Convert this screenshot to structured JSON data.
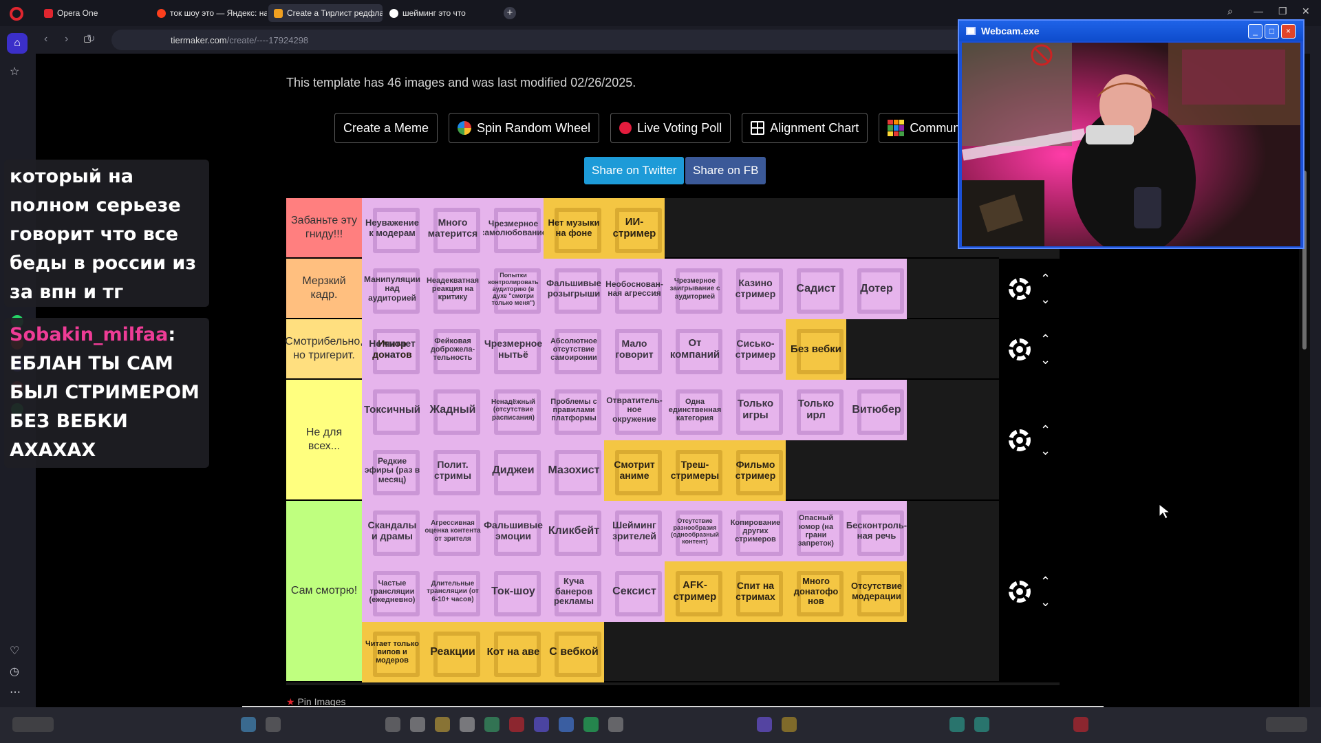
{
  "browser": {
    "tabs": [
      {
        "label": "Opera One",
        "active": false
      },
      {
        "label": "ток шоу это — Яндекс: на",
        "active": false
      },
      {
        "label": "Create a Тирлист редфлаг",
        "active": true
      },
      {
        "label": "шейминг это что",
        "active": false
      }
    ],
    "url_domain": "tiermaker.com",
    "url_path": "/create/----17924298",
    "new_tab": "+"
  },
  "page": {
    "template_info": "This template has 46 images and was last modified 02/26/2025.",
    "buttons": {
      "create_meme": "Create a Meme",
      "spin_wheel": "Spin Random Wheel",
      "live_poll": "Live Voting Poll",
      "alignment_chart": "Alignment Chart",
      "community": "Commun"
    },
    "share_twitter": "Share on Twitter",
    "share_fb": "Share on FB",
    "pin_images": "Pin Images"
  },
  "tiers": [
    {
      "label": "Забаньте эту гниду!!!",
      "color": "#ff7f7f",
      "items": [
        {
          "text": "Неуважение к модерам",
          "color": "pink"
        },
        {
          "text": "Много матерится",
          "color": "pink"
        },
        {
          "text": "Чрезмерное самолюбование",
          "color": "pink"
        },
        {
          "text": "Нет музыки на фоне",
          "color": "gold"
        },
        {
          "text": "ИИ-стример",
          "color": "gold"
        }
      ]
    },
    {
      "label": "Мерзкий кадр.",
      "color": "#ffbf7f",
      "items": [
        {
          "text": "Манипуляции над аудиторией",
          "color": "pink"
        },
        {
          "text": "Неадекватная реакция на критику",
          "color": "pink"
        },
        {
          "text": "Попытки контролировать аудиторию (в духе \"смотри только меня\")",
          "color": "pink"
        },
        {
          "text": "Фальшивые розыгрыши",
          "color": "pink"
        },
        {
          "text": "Необоснован-ная агрессия",
          "color": "pink"
        },
        {
          "text": "Чрезмерное заигрывание с аудиторией",
          "color": "pink"
        },
        {
          "text": "Казино стример",
          "color": "pink"
        },
        {
          "text": "Садист",
          "color": "pink"
        },
        {
          "text": "Дотер",
          "color": "pink"
        },
        {
          "text": "Игнор донатов",
          "color": "gold"
        }
      ]
    },
    {
      "label": "Смотрибельно, но тригерит.",
      "color": "#ffdf7f",
      "items": [
        {
          "text": "Не читает чат",
          "color": "pink"
        },
        {
          "text": "Фейковая доброжела-тельность",
          "color": "pink"
        },
        {
          "text": "Чрезмерное нытьё",
          "color": "pink"
        },
        {
          "text": "Абсолютное отсутствие самоиронии",
          "color": "pink"
        },
        {
          "text": "Мало говорит",
          "color": "pink"
        },
        {
          "text": "От компаний",
          "color": "pink"
        },
        {
          "text": "Сисько-стример",
          "color": "pink"
        },
        {
          "text": "Без вебки",
          "color": "gold"
        }
      ]
    },
    {
      "label": "Не для всех...",
      "color": "#ffff7f",
      "items": [
        {
          "text": "Токсичный",
          "color": "pink"
        },
        {
          "text": "Жадный",
          "color": "pink"
        },
        {
          "text": "Ненадёжный (отсутствие расписания)",
          "color": "pink"
        },
        {
          "text": "Проблемы с правилами платформы",
          "color": "pink"
        },
        {
          "text": "Отвратитель-ное окружение",
          "color": "pink"
        },
        {
          "text": "Одна единственная категория",
          "color": "pink"
        },
        {
          "text": "Только игры",
          "color": "pink"
        },
        {
          "text": "Только ирл",
          "color": "pink"
        },
        {
          "text": "Витюбер",
          "color": "pink"
        },
        {
          "text": "Редкие эфиры (раз в месяц)",
          "color": "pink"
        },
        {
          "text": "Полит. стримы",
          "color": "pink"
        },
        {
          "text": "Диджеи",
          "color": "pink"
        },
        {
          "text": "Мазохист",
          "color": "pink"
        },
        {
          "text": "Смотрит аниме",
          "color": "gold"
        },
        {
          "text": "Треш-стримеры",
          "color": "gold"
        },
        {
          "text": "Фильмо стример",
          "color": "gold"
        }
      ]
    },
    {
      "label": "Сам смотрю!",
      "color": "#bfff7f",
      "items": [
        {
          "text": "Скандалы и драмы",
          "color": "pink"
        },
        {
          "text": "Агрессивная оценка контента от зрителя",
          "color": "pink"
        },
        {
          "text": "Фальшивые эмоции",
          "color": "pink"
        },
        {
          "text": "Кликбейт",
          "color": "pink"
        },
        {
          "text": "Шейминг зрителей",
          "color": "pink"
        },
        {
          "text": "Отсутствие разнообразия (однообразный контент)",
          "color": "pink"
        },
        {
          "text": "Копирование других стримеров",
          "color": "pink"
        },
        {
          "text": "Опасный юмор (на грани запреток)",
          "color": "pink"
        },
        {
          "text": "Бесконтроль-ная речь",
          "color": "pink"
        },
        {
          "text": "Частые трансляции (ежедневно)",
          "color": "pink"
        },
        {
          "text": "Длительные трансляции (от 6-10+ часов)",
          "color": "pink"
        },
        {
          "text": "Ток-шоу",
          "color": "pink"
        },
        {
          "text": "Куча банеров рекламы",
          "color": "pink"
        },
        {
          "text": "Сексист",
          "color": "pink"
        },
        {
          "text": "AFK-стример",
          "color": "gold"
        },
        {
          "text": "Спит на стримах",
          "color": "gold"
        },
        {
          "text": "Много донатофо нов",
          "color": "gold"
        },
        {
          "text": "Отсутствие модерации",
          "color": "gold"
        },
        {
          "text": "Читает только випов и модеров",
          "color": "gold"
        },
        {
          "text": "Реакции",
          "color": "gold"
        },
        {
          "text": "Кот на аве",
          "color": "gold"
        },
        {
          "text": "С вебкой",
          "color": "gold"
        }
      ]
    }
  ],
  "chat": {
    "message1": "который на полном серьезе говорит что все беды в россии из за впн и тг",
    "user2": "Sobakin_milfaa",
    "colon": ":",
    "message2": "ЕБЛАН ТЫ САМ БЫЛ СТРИМЕРОМ БЕЗ ВЕБКИ АХАХАХ"
  },
  "webcam": {
    "title": "Webcam.exe",
    "min": "_",
    "max": "□",
    "close": "×"
  },
  "colors": {
    "twitter": "#1d9bd8",
    "facebook": "#3b5998",
    "item_pink": "#e6b4ec",
    "item_gold": "#f4c643",
    "webcam_frame": "#1a4fd6"
  }
}
